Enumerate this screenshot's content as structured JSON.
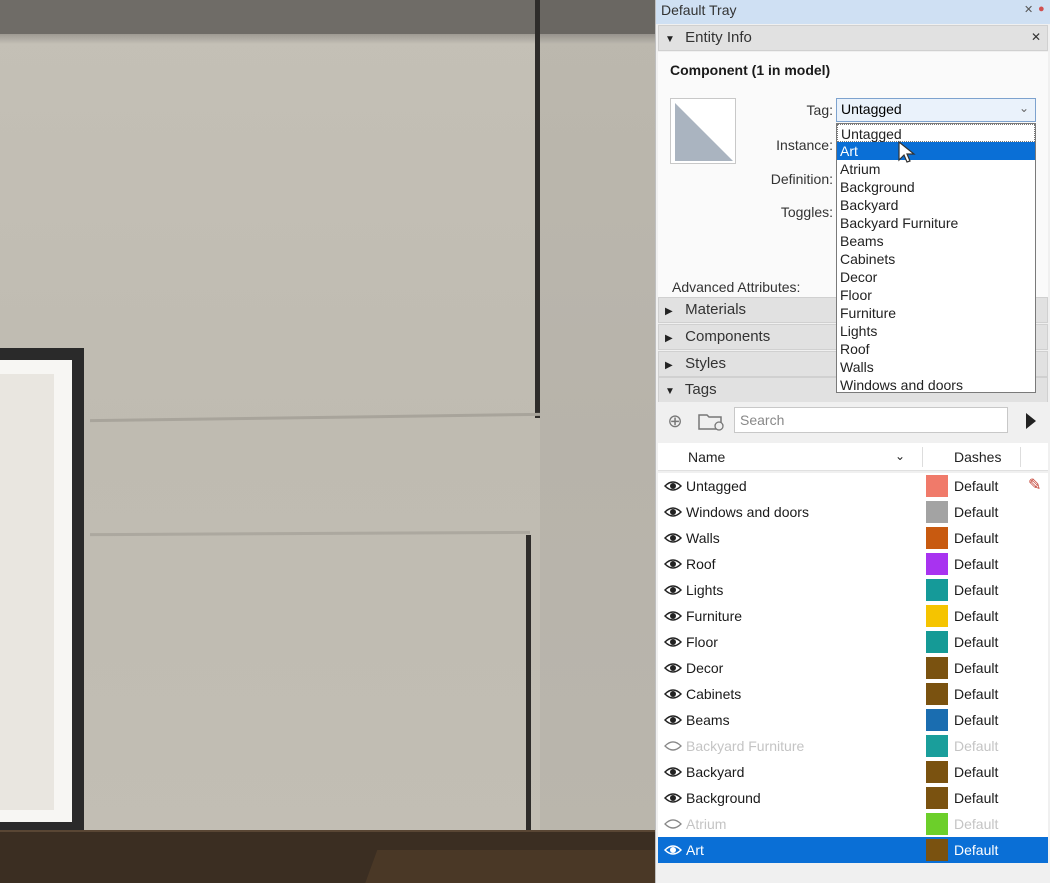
{
  "tray": {
    "title": "Default Tray"
  },
  "entity_info": {
    "header": "Entity Info",
    "component_title": "Component (1 in model)",
    "labels": {
      "tag": "Tag:",
      "instance": "Instance:",
      "definition": "Definition:",
      "toggles": "Toggles:",
      "advanced": "Advanced Attributes:"
    },
    "tag_value": "Untagged"
  },
  "tag_dropdown": {
    "options": [
      "Untagged",
      "Art",
      "Atrium",
      "Background",
      "Backyard",
      "Backyard Furniture",
      "Beams",
      "Cabinets",
      "Decor",
      "Floor",
      "Furniture",
      "Lights",
      "Roof",
      "Walls",
      "Windows and doors"
    ],
    "highlighted": "Art"
  },
  "panels": {
    "materials": "Materials",
    "components": "Components",
    "styles": "Styles",
    "tags": "Tags"
  },
  "tags_panel": {
    "search_placeholder": "Search",
    "col_name": "Name",
    "col_dashes": "Dashes",
    "rows": [
      {
        "name": "Untagged",
        "color": "#f07a6a",
        "dashes": "Default",
        "visible": true
      },
      {
        "name": "Windows and doors",
        "color": "#a3a3a3",
        "dashes": "Default",
        "visible": true
      },
      {
        "name": "Walls",
        "color": "#c85a10",
        "dashes": "Default",
        "visible": true
      },
      {
        "name": "Roof",
        "color": "#a833f0",
        "dashes": "Default",
        "visible": true
      },
      {
        "name": "Lights",
        "color": "#159a99",
        "dashes": "Default",
        "visible": true
      },
      {
        "name": "Furniture",
        "color": "#f5c400",
        "dashes": "Default",
        "visible": true
      },
      {
        "name": "Floor",
        "color": "#159a96",
        "dashes": "Default",
        "visible": true
      },
      {
        "name": "Decor",
        "color": "#7a5210",
        "dashes": "Default",
        "visible": true
      },
      {
        "name": "Cabinets",
        "color": "#7a5210",
        "dashes": "Default",
        "visible": true
      },
      {
        "name": "Beams",
        "color": "#1a6db0",
        "dashes": "Default",
        "visible": true
      },
      {
        "name": "Backyard Furniture",
        "color": "#1a9e9b",
        "dashes": "Default",
        "visible": false
      },
      {
        "name": "Backyard",
        "color": "#7a5210",
        "dashes": "Default",
        "visible": true
      },
      {
        "name": "Background",
        "color": "#7a5210",
        "dashes": "Default",
        "visible": true
      },
      {
        "name": "Atrium",
        "color": "#6ccf2a",
        "dashes": "Default",
        "visible": false
      },
      {
        "name": "Art",
        "color": "#7a5210",
        "dashes": "Default",
        "visible": true,
        "selected": true
      }
    ]
  },
  "colors": {
    "accent": "#0a6fd6"
  }
}
